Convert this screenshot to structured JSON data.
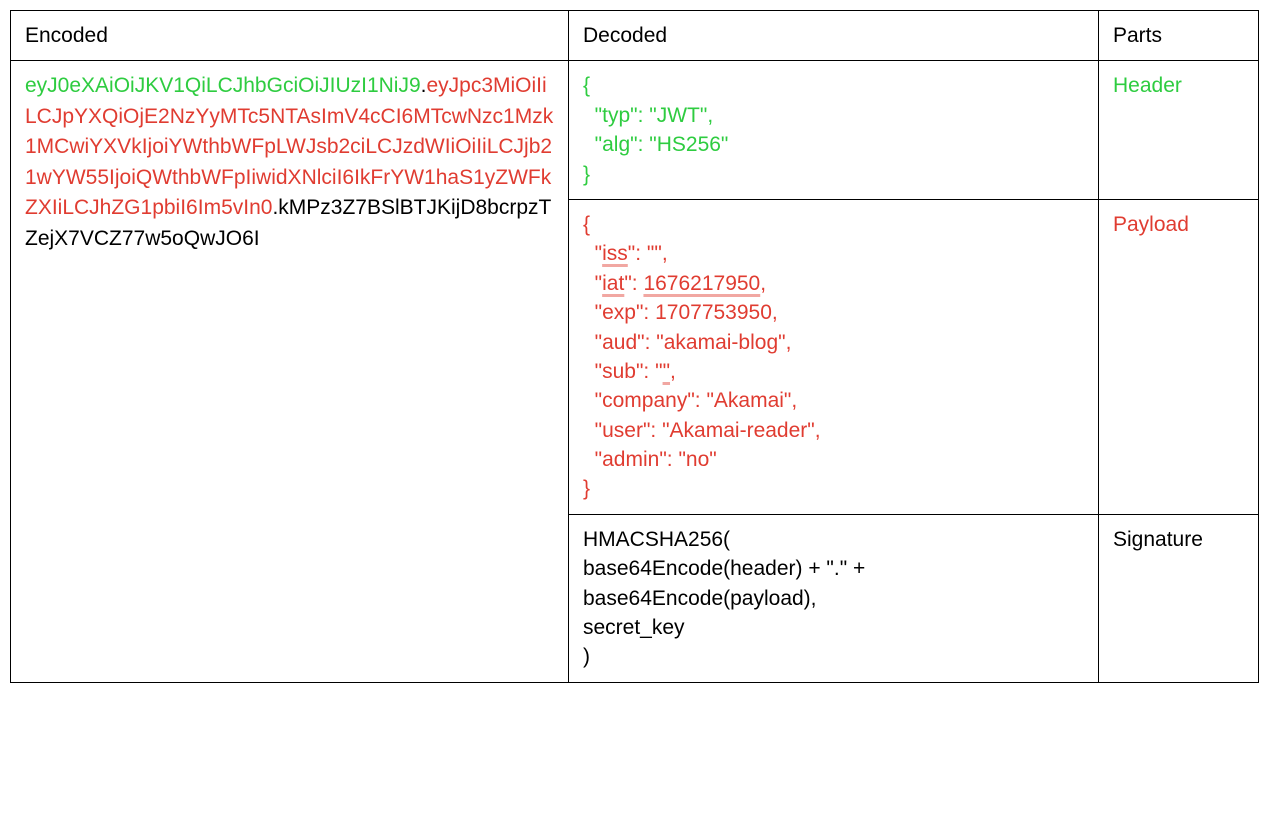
{
  "headers": {
    "encoded": "Encoded",
    "decoded": "Decoded",
    "parts": "Parts"
  },
  "encoded": {
    "header_segment": "eyJ0eXAiOiJKV1QiLCJhbGciOiJIUzI1NiJ9",
    "dot1": ".",
    "payload_segment": "eyJpc3MiOiIiLCJpYXQiOjE2NzYyMTc5NTAsImV4cCI6MTcwNzc1Mzk1MCwiYXVkIjoiYWthbWFpLWJsb2ciLCJzdWIiOiIiLCJjb21wYW55IjoiQWthbWFpIiwidXNlciI6IkFrYW1haS1yZWFkZXIiLCJhZG1pbiI6Im5vIn0",
    "dot2": ".",
    "signature_segment": "kMPz3Z7BSlBTJKijD8bcrpzTZejX7VCZ77w5oQwJO6I"
  },
  "decoded": {
    "header_json": "{\n  \"typ\": \"JWT\",\n  \"alg\": \"HS256\"\n}",
    "payload_open_brace": "{",
    "payload_l1_a": "  \"",
    "payload_l1_b": "iss",
    "payload_l1_c": "\": \"\",",
    "payload_l2_a": "  \"",
    "payload_l2_b": "iat",
    "payload_l2_c": "\": ",
    "payload_l2_d": "1676217950",
    "payload_l2_e": ",",
    "payload_l3": "  \"exp\": 1707753950,",
    "payload_l4": "  \"aud\": \"akamai-blog\",",
    "payload_l5_a": "  \"sub\": \"",
    "payload_l5_b": "\"",
    "payload_l5_c": ",",
    "payload_l6": "  \"company\": \"Akamai\",",
    "payload_l7": "  \"user\": \"Akamai-reader\",",
    "payload_l8": "  \"admin\": \"no\"",
    "payload_close_brace": "}",
    "signature_text": "HMACSHA256(\nbase64Encode(header) + \".\" +\nbase64Encode(payload),\nsecret_key\n)"
  },
  "parts": {
    "header": "Header",
    "payload": "Payload",
    "signature": "Signature"
  }
}
